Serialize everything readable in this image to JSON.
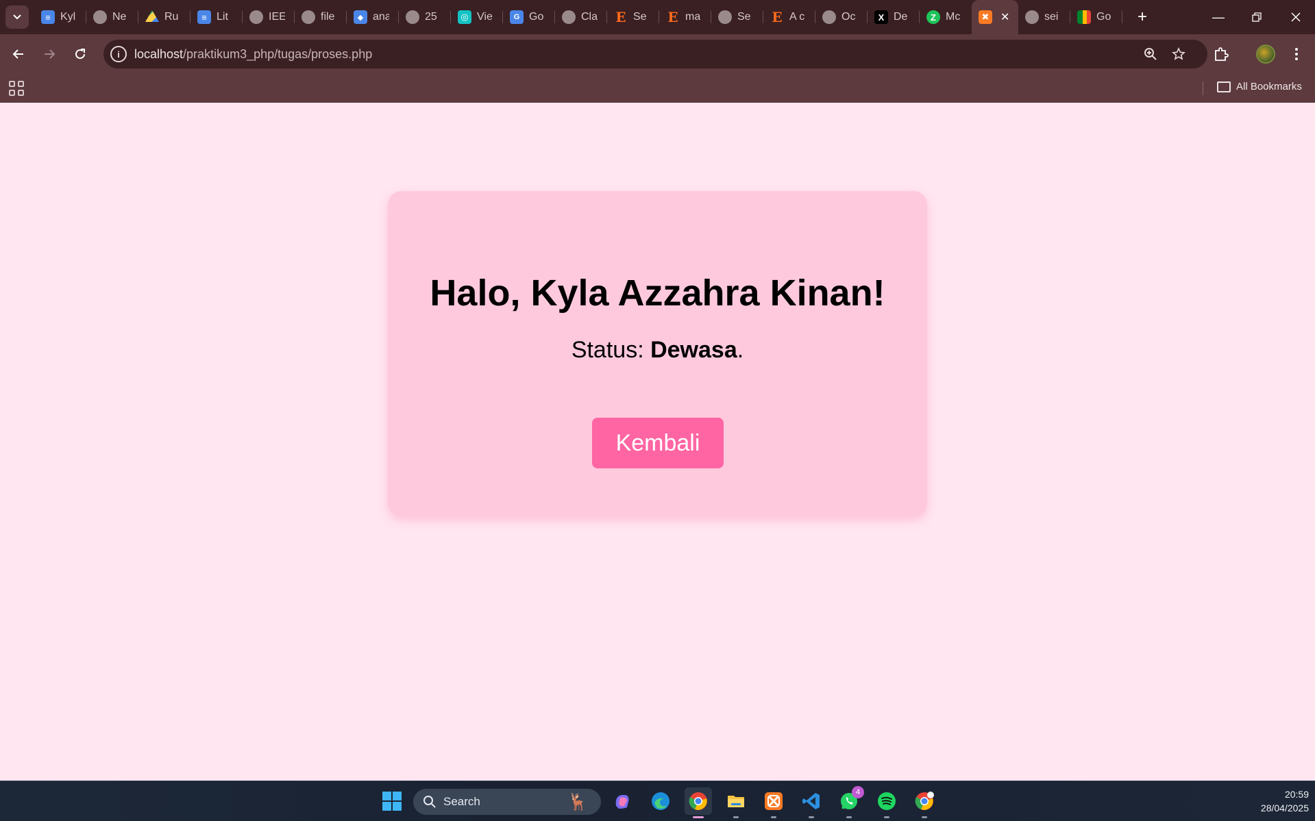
{
  "browser": {
    "tabs": [
      {
        "label": "Kyl",
        "favicon": "docs-icon"
      },
      {
        "label": "Ne",
        "favicon": "chrome-icon"
      },
      {
        "label": "Ru",
        "favicon": "drive-icon"
      },
      {
        "label": "Lit",
        "favicon": "docs-icon"
      },
      {
        "label": "IEE",
        "favicon": "globe-icon"
      },
      {
        "label": "file",
        "favicon": "globe-icon"
      },
      {
        "label": "ana",
        "favicon": "classroom-icon"
      },
      {
        "label": "25",
        "favicon": "globe-icon"
      },
      {
        "label": "Vie",
        "favicon": "teal-icon"
      },
      {
        "label": "Go",
        "favicon": "translate-icon"
      },
      {
        "label": "Cla",
        "favicon": "globe-icon"
      },
      {
        "label": "Se",
        "favicon": "e-icon"
      },
      {
        "label": "ma",
        "favicon": "e-icon"
      },
      {
        "label": "Se",
        "favicon": "globe-icon"
      },
      {
        "label": "A c",
        "favicon": "e-icon"
      },
      {
        "label": "Oc",
        "favicon": "globe-icon"
      },
      {
        "label": "De",
        "favicon": "x-icon"
      },
      {
        "label": "Mc",
        "favicon": "green-icon"
      },
      {
        "label": "",
        "favicon": "xampp-icon",
        "active": true
      },
      {
        "label": "sei",
        "favicon": "globe-icon"
      },
      {
        "label": "Go",
        "favicon": "meet-icon"
      }
    ],
    "url_host": "localhost",
    "url_path": "/praktikum3_php/tugas/proses.php",
    "bookmarks_all": "All Bookmarks"
  },
  "page": {
    "greeting": "Halo, Kyla Azzahra Kinan!",
    "status_prefix": "Status: ",
    "status_value": "Dewasa",
    "status_suffix": ".",
    "back_button": "Kembali"
  },
  "taskbar": {
    "search_placeholder": "Search",
    "whatsapp_badge": "4",
    "time": "20:59",
    "date": "28/04/2025"
  },
  "colors": {
    "page_bg": "#ffe6f0",
    "card_bg": "#ffc9dd",
    "button_bg": "#ff65a3",
    "chrome_bg": "#5c3a3e",
    "tabstrip_bg": "#3a2023"
  }
}
